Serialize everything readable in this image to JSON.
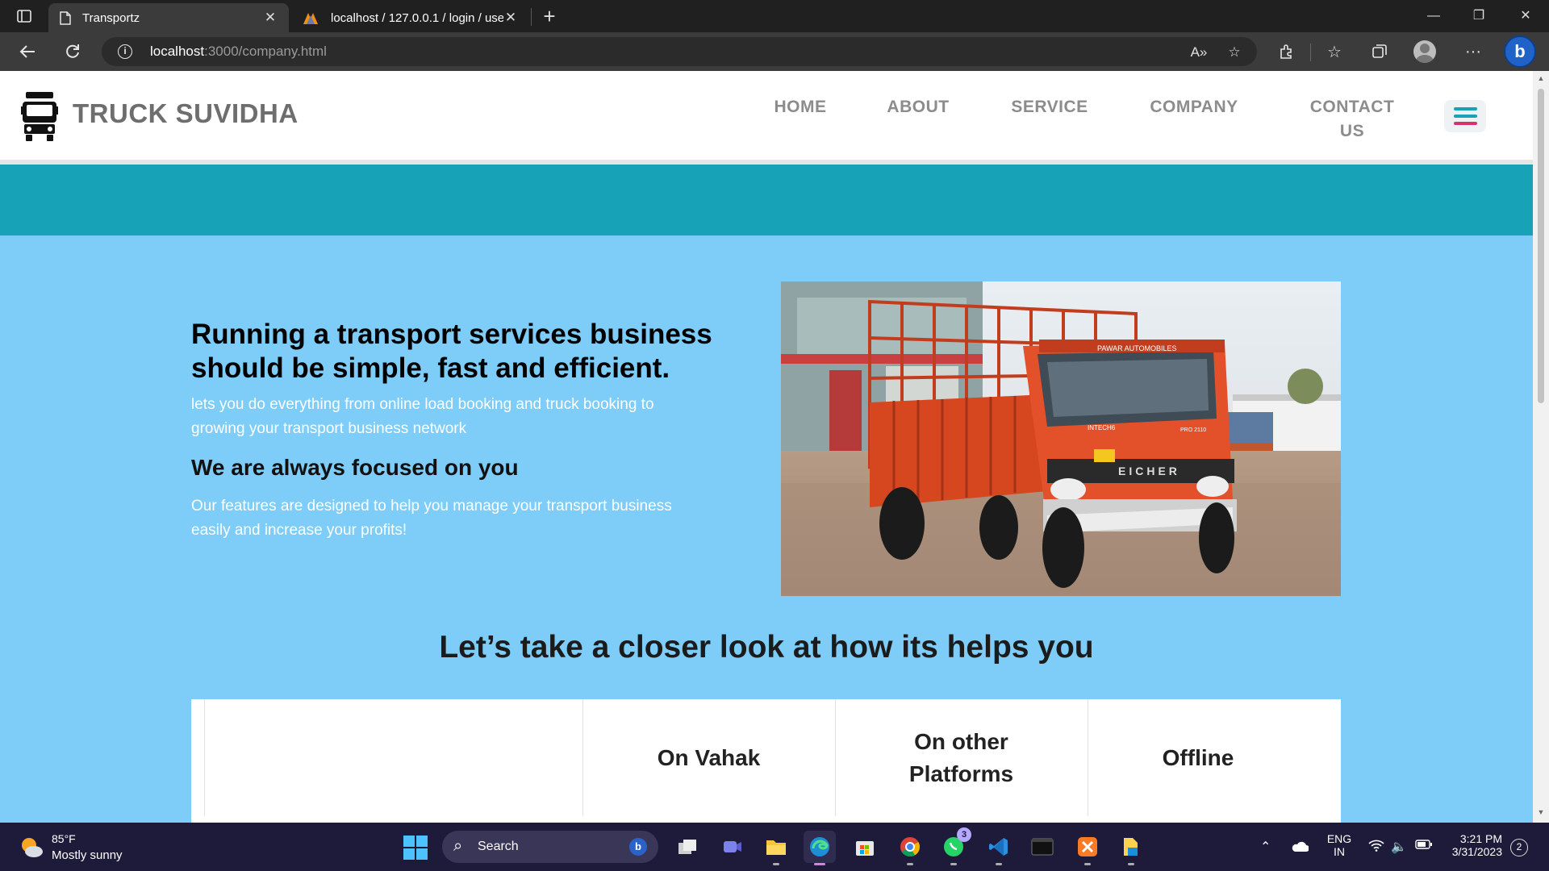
{
  "browser": {
    "tabs": [
      {
        "title": "Transportz",
        "active": true
      },
      {
        "title": "localhost / 127.0.0.1 / login / use",
        "active": false
      }
    ],
    "url": {
      "host": "localhost",
      "rest": ":3000/company.html"
    }
  },
  "site": {
    "brand": "TRUCK SUVIDHA",
    "nav": [
      {
        "label": "HOME"
      },
      {
        "label": "ABOUT"
      },
      {
        "label": "SERVICE"
      },
      {
        "label": "COMPANY"
      },
      {
        "label": "CONTACT US"
      }
    ],
    "hero": {
      "title": "Running a transport services business should be simple, fast and efficient.",
      "text1": "lets you do everything from online load booking and truck booking to growing your transport business network",
      "subtitle": "We are always focused on you",
      "text2": "Our features are designed to help you manage your transport business easily and increase your profits!"
    },
    "truck_photo_text": {
      "plate_brand": "EICHER",
      "dealer": "PAWAR AUTOMOBILES",
      "badge": "PRO 2110",
      "model": "INTECH6"
    },
    "closer_title": "Let’s take a closer look at how its helps you",
    "compare_columns": [
      "",
      "On Vahak",
      "On other Platforms",
      "Offline"
    ],
    "colors": {
      "page_bg": "#7dcdf8",
      "teal_band": "#17a2b8",
      "hamburger_top": "#17a2b8",
      "hamburger_bottom": "#d6336c"
    }
  },
  "taskbar": {
    "weather": {
      "temp": "85°F",
      "desc": "Mostly sunny"
    },
    "search_label": "Search",
    "apps": [
      "task-view",
      "teams-meet",
      "file-explorer",
      "edge",
      "microsoft-store",
      "chrome",
      "whatsapp",
      "vscode",
      "terminal",
      "xampp",
      "sticky-files"
    ],
    "whatsapp_badge": "3",
    "lang": {
      "line1": "ENG",
      "line2": "IN"
    },
    "clock": {
      "time": "3:21 PM",
      "date": "3/31/2023"
    },
    "notifications": "2"
  }
}
